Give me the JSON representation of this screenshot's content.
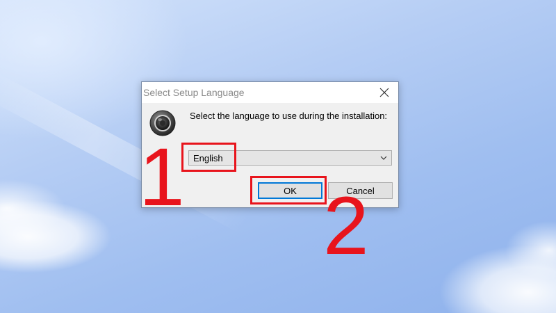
{
  "dialog": {
    "title": "Select Setup Language",
    "close_label": "×",
    "prompt": "Select the language to use during the installation:",
    "language_select": {
      "selected": "English"
    },
    "buttons": {
      "ok": "OK",
      "cancel": "Cancel"
    },
    "icons": {
      "app": "speaker-icon",
      "close": "close-icon",
      "dropdown": "chevron-down-icon"
    }
  },
  "annotations": {
    "step1": "1",
    "step2": "2",
    "color": "#e8141c"
  }
}
